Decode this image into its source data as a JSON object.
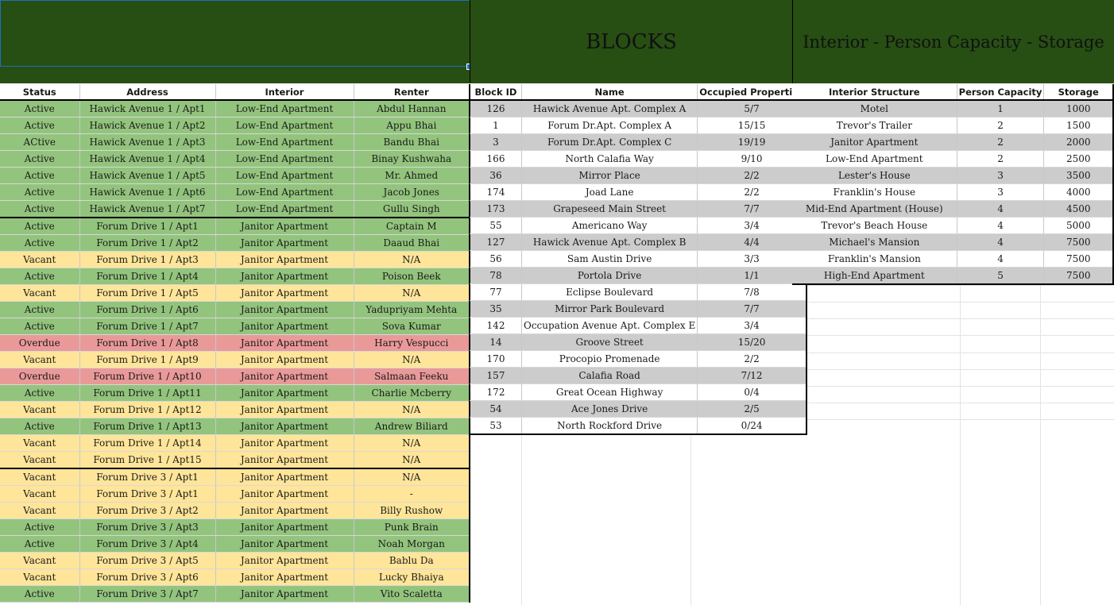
{
  "banners": {
    "left": "",
    "blocks": "BLOCKS",
    "interior": "Interior - Person Capacity - Storage"
  },
  "properties": {
    "headers": [
      "Status",
      "Address",
      "Interior",
      "Renter"
    ],
    "rows": [
      [
        "Active",
        "Hawick Avenue 1 / Apt1",
        "Low-End Apartment",
        "Abdul Hannan"
      ],
      [
        "Active",
        "Hawick Avenue 1 / Apt2",
        "Low-End Apartment",
        "Appu Bhai"
      ],
      [
        "ACtive",
        "Hawick Avenue 1 / Apt3",
        "Low-End Apartment",
        "Bandu Bhai"
      ],
      [
        "Active",
        "Hawick Avenue 1 / Apt4",
        "Low-End Apartment",
        "Binay Kushwaha"
      ],
      [
        "Active",
        "Hawick Avenue 1 / Apt5",
        "Low-End Apartment",
        "Mr. Ahmed"
      ],
      [
        "Active",
        "Hawick Avenue 1 / Apt6",
        "Low-End Apartment",
        "Jacob Jones"
      ],
      [
        "Active",
        "Hawick Avenue 1 / Apt7",
        "Low-End Apartment",
        "Gullu Singh"
      ],
      [
        "Active",
        "Forum Drive 1 / Apt1",
        "Janitor Apartment",
        "Captain M"
      ],
      [
        "Active",
        "Forum Drive 1 / Apt2",
        "Janitor Apartment",
        "Daaud Bhai"
      ],
      [
        "Vacant",
        "Forum Drive 1 / Apt3",
        "Janitor Apartment",
        "N/A"
      ],
      [
        "Active",
        "Forum Drive 1 / Apt4",
        "Janitor Apartment",
        "Poison Beek"
      ],
      [
        "Vacant",
        "Forum Drive 1 / Apt5",
        "Janitor Apartment",
        "N/A"
      ],
      [
        "Active",
        "Forum Drive 1 / Apt6",
        "Janitor Apartment",
        "Yadupriyam Mehta"
      ],
      [
        "Active",
        "Forum Drive 1 / Apt7",
        "Janitor Apartment",
        "Sova Kumar"
      ],
      [
        "Overdue",
        "Forum Drive 1 / Apt8",
        "Janitor Apartment",
        "Harry Vespucci"
      ],
      [
        "Vacant",
        "Forum Drive 1 / Apt9",
        "Janitor Apartment",
        "N/A"
      ],
      [
        "Overdue",
        "Forum Drive 1 / Apt10",
        "Janitor Apartment",
        "Salmaan Feeku"
      ],
      [
        "Active",
        "Forum Drive 1 / Apt11",
        "Janitor Apartment",
        "Charlie Mcberry"
      ],
      [
        "Vacant",
        "Forum Drive 1 / Apt12",
        "Janitor Apartment",
        "N/A"
      ],
      [
        "Active",
        "Forum Drive 1 / Apt13",
        "Janitor Apartment",
        "Andrew Biliard"
      ],
      [
        "Vacant",
        "Forum Drive 1 / Apt14",
        "Janitor Apartment",
        "N/A"
      ],
      [
        "Vacant",
        "Forum Drive 1 / Apt15",
        "Janitor Apartment",
        "N/A"
      ],
      [
        "Vacant",
        "Forum Drive 3 / Apt1",
        "Janitor Apartment",
        "N/A"
      ],
      [
        "Vacant",
        "Forum Drive 3 / Apt1",
        "Janitor Apartment",
        "-"
      ],
      [
        "Vacant",
        "Forum Drive 3 / Apt2",
        "Janitor Apartment",
        "Billy Rushow"
      ],
      [
        "Active",
        "Forum Drive 3 / Apt3",
        "Janitor Apartment",
        "Punk Brain"
      ],
      [
        "Active",
        "Forum Drive 3 / Apt4",
        "Janitor Apartment",
        "Noah Morgan"
      ],
      [
        "Vacant",
        "Forum Drive 3 / Apt5",
        "Janitor Apartment",
        "Bablu Da"
      ],
      [
        "Vacant",
        "Forum Drive 3 / Apt6",
        "Janitor Apartment",
        "Lucky Bhaiya"
      ],
      [
        "Active",
        "Forum Drive 3 / Apt7",
        "Janitor Apartment",
        "Vito Scaletta"
      ]
    ]
  },
  "blocks": {
    "headers": [
      "Block ID",
      "Name",
      "Occupied Properties"
    ],
    "rows": [
      [
        "126",
        "Hawick Avenue Apt. Complex A",
        "5/7"
      ],
      [
        "1",
        "Forum Dr.Apt. Complex A",
        "15/15"
      ],
      [
        "3",
        "Forum Dr.Apt. Complex C",
        "19/19"
      ],
      [
        "166",
        "North Calafia Way",
        "9/10"
      ],
      [
        "36",
        "Mirror Place",
        "2/2"
      ],
      [
        "174",
        "Joad Lane",
        "2/2"
      ],
      [
        "173",
        "Grapeseed Main Street",
        "7/7"
      ],
      [
        "55",
        "Americano Way",
        "3/4"
      ],
      [
        "127",
        "Hawick Avenue Apt. Complex B",
        "4/4"
      ],
      [
        "56",
        "Sam Austin Drive",
        "3/3"
      ],
      [
        "78",
        "Portola Drive",
        "1/1"
      ],
      [
        "77",
        "Eclipse Boulevard",
        "7/8"
      ],
      [
        "35",
        "Mirror Park Boulevard",
        "7/7"
      ],
      [
        "142",
        "Occupation Avenue Apt. Complex E",
        "3/4"
      ],
      [
        "14",
        "Groove Street",
        "15/20"
      ],
      [
        "170",
        "Procopio Promenade",
        "2/2"
      ],
      [
        "157",
        "Calafia Road",
        "7/12"
      ],
      [
        "172",
        "Great Ocean Highway",
        "0/4"
      ],
      [
        "54",
        "Ace Jones Drive",
        "2/5"
      ],
      [
        "53",
        "North Rockford Drive",
        "0/24"
      ]
    ]
  },
  "interiors": {
    "headers": [
      "Interior Structure",
      "Person Capacity",
      "Storage"
    ],
    "rows": [
      [
        "Motel",
        "1",
        "1000"
      ],
      [
        "Trevor's Trailer",
        "2",
        "1500"
      ],
      [
        "Janitor Apartment",
        "2",
        "2000"
      ],
      [
        "Low-End Apartment",
        "2",
        "2500"
      ],
      [
        "Lester's House",
        "3",
        "3500"
      ],
      [
        "Franklin's House",
        "3",
        "4000"
      ],
      [
        "Mid-End Apartment (House)",
        "4",
        "4500"
      ],
      [
        "Trevor's Beach House",
        "4",
        "5000"
      ],
      [
        "Michael's Mansion",
        "4",
        "7500"
      ],
      [
        "Franklin's Mansion",
        "4",
        "7500"
      ],
      [
        "High-End Apartment",
        "5",
        "7500"
      ]
    ]
  },
  "colors": {
    "banner": "#274e13",
    "active": "#93c47d",
    "vacant": "#ffe599",
    "overdue": "#ea9999",
    "grey_row": "#cccccc"
  }
}
